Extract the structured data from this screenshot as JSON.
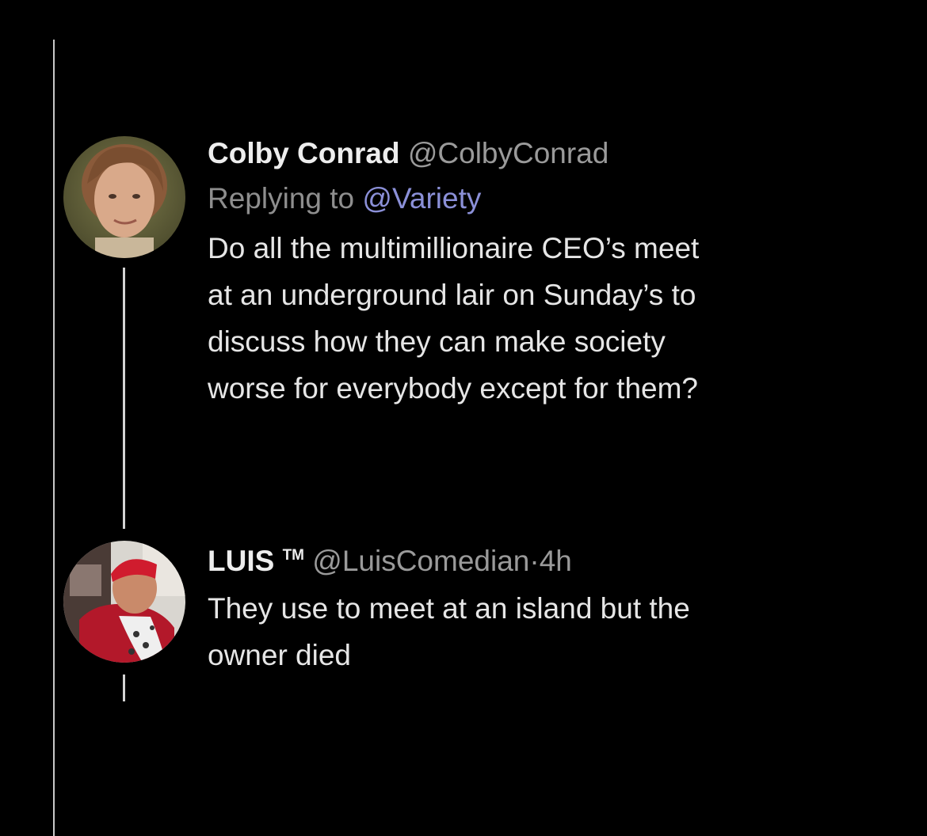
{
  "colors": {
    "background": "#000000",
    "text": "#e6e6e6",
    "muted": "#9a9a9a",
    "mention": "#8b90d8",
    "thread_line": "#d4d4d4"
  },
  "tweets": [
    {
      "avatar_icon": "person-photo-icon",
      "display_name": "Colby Conrad",
      "handle": "@ColbyConrad",
      "reply_prefix": "Replying to",
      "reply_to": "@Variety",
      "text": "Do all the multimillionaire CEO’s meet\nat an underground lair on Sunday’s to\ndiscuss how they can make society\nworse for everybody except for them?"
    },
    {
      "avatar_icon": "person-photo-icon",
      "display_name": "LUIS",
      "badge": "TM",
      "handle": "@LuisComedian",
      "separator": "·",
      "time": "4h",
      "text": "They use to meet at an island but the\nowner died"
    }
  ]
}
